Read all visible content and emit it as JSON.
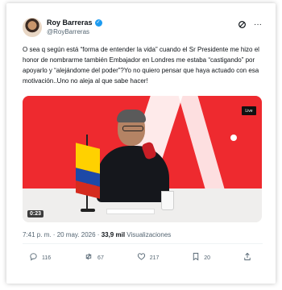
{
  "author": {
    "name": "Roy Barreras",
    "handle": "@RoyBarreras",
    "verified": true
  },
  "header_icons": [
    "grok-icon",
    "more-icon"
  ],
  "tweet": {
    "text": "O sea q según está “forma de entender la vida” cuando el Sr Presidente me hizo el honor de nombrarme también Embajador en Londres me estaba “castigando” por apoyarlo y “alejándome del poder”?Yo no quiero pensar que haya actuado con esa motivación..Uno no aleja al que sabe hacer!"
  },
  "media": {
    "duration": "0:23",
    "badge": "Live"
  },
  "meta": {
    "time": "7:41 p. m.",
    "separator": " · ",
    "date": "20 may. 2026",
    "views_count": "33,9 mil",
    "views_label": "Visualizaciones"
  },
  "actions": {
    "replies": "116",
    "reposts": "67",
    "likes": "217",
    "bookmarks": "20"
  },
  "colors": {
    "verified": "#1d9bf0",
    "text": "#0f1419",
    "secondary": "#536471",
    "studio_red": "#ee2a2f"
  }
}
